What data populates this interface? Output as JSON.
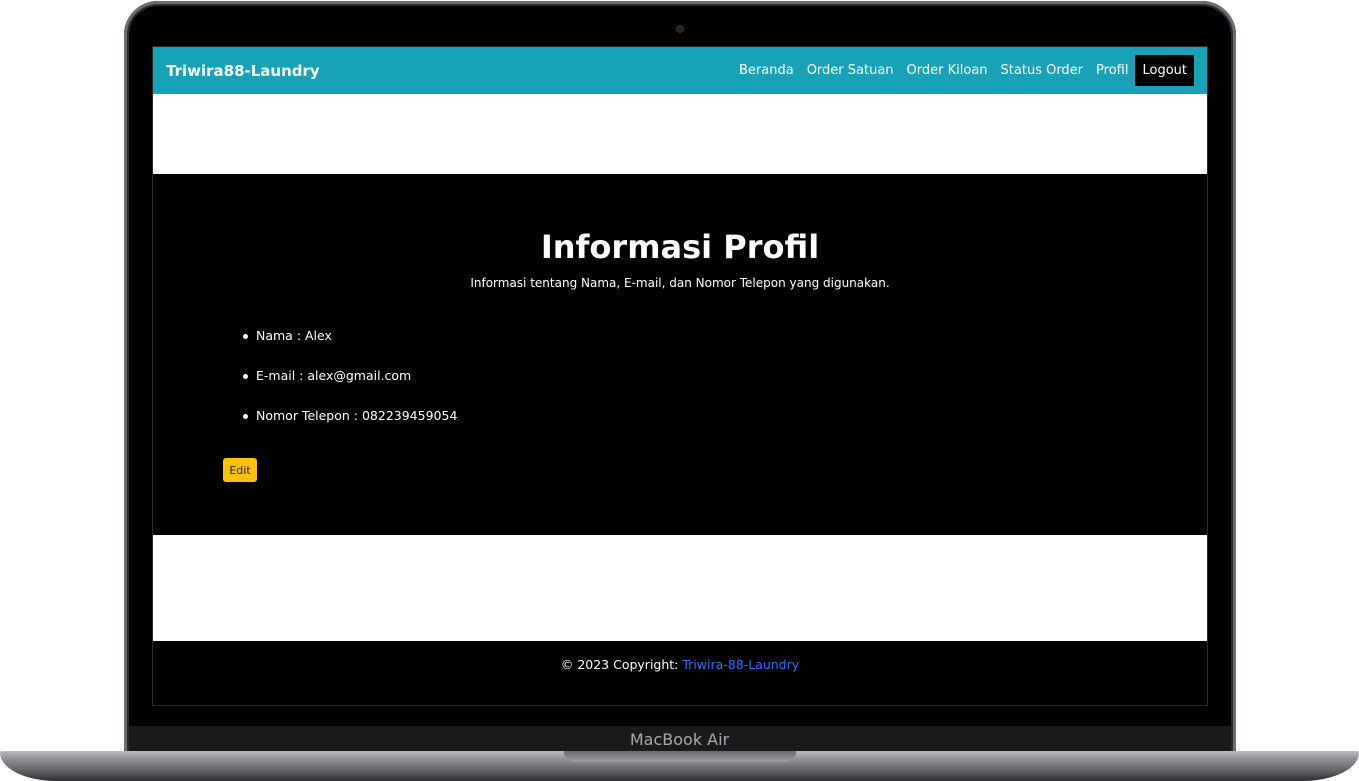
{
  "device": {
    "model_label": "MacBook Air"
  },
  "navbar": {
    "brand": "Triwira88-Laundry",
    "links": [
      "Beranda",
      "Order Satuan",
      "Order Kiloan",
      "Status Order",
      "Profil"
    ],
    "logout_label": "Logout"
  },
  "profile": {
    "title": "Informasi Profil",
    "subtitle": "Informasi tentang Nama, E-mail, dan Nomor Telepon yang digunakan.",
    "items": [
      "Nama : Alex",
      "E-mail : alex@gmail.com",
      "Nomor Telepon : 082239459054"
    ],
    "edit_label": "Edit"
  },
  "footer": {
    "copyright": "© 2023 Copyright: ",
    "link_text": "Triwira-88-Laundry"
  }
}
